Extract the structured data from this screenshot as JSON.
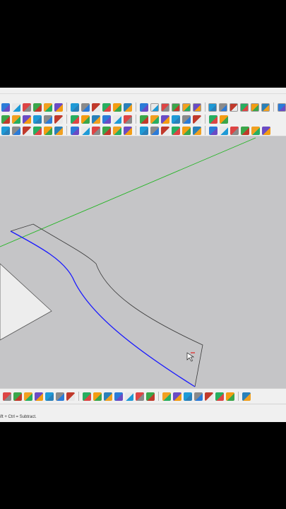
{
  "app": {
    "status_hint": "ift + Ctrl = Subtract."
  },
  "colors": {
    "viewport_bg": "#c5c5c7",
    "green_axis": "#22b522",
    "selected_edge": "#1a1aff",
    "face_edge": "#3a3a3a",
    "ground_plane": "#ededed",
    "cursor_red": "#e02020"
  },
  "toolbar_rows": [
    {
      "icons": [
        "select-icon",
        "lasso-icon",
        "pan-icon",
        "walk-icon",
        "zoom-icon",
        "zoom-extents-icon",
        "orbit-icon",
        "section-icon",
        "section-plane-icon",
        "mirror-icon",
        "person-icon",
        "add-location-icon",
        "iso-view-icon",
        "top-view-icon",
        "front-view-icon",
        "camera-icon",
        "tape-icon",
        "rotate-icon",
        "gear-icon",
        "cube-icon",
        "component-icon",
        "shaded-icon",
        "material-icon",
        "cloud-icon",
        "box-icon"
      ]
    },
    {
      "icons": [
        "paint-icon",
        "box-solid-icon",
        "layer-icon",
        "push-pull-icon",
        "dims-icon",
        "warehouse-icon",
        "paint-bucket-icon",
        "cube-red-icon",
        "cube-green-icon",
        "style-icon",
        "settings-hex-icon",
        "settings-hex-2-icon",
        "undo-icon",
        "redo-icon",
        "play-icon",
        "capture-icon",
        "next-icon",
        "shadow-icon",
        "group-icon",
        "copy-icon"
      ]
    },
    {
      "icons": [
        "material-orange-icon",
        "scissors-icon",
        "curve-icon",
        "frame-icon",
        "frame-2-icon",
        "hex-icon",
        "molecule-icon",
        "sheet-icon",
        "sheet-2-icon",
        "sheet-3-icon",
        "sheet-4-icon",
        "sheet-5-icon",
        "sheet-6-icon",
        "sheet-7-icon",
        "sheet-8-icon",
        "sheet-9-icon",
        "sheet-10-icon",
        "fold-icon",
        "house-icon",
        "pencil-icon",
        "arc-icon",
        "sweep-icon",
        "bend-icon",
        "nurbs-icon"
      ]
    }
  ],
  "bottom_icons": [
    "funnel-icon",
    "filter-icon",
    "lasso-select-icon",
    "explode-icon",
    "shrink-icon",
    "expand-icon",
    "prev-next-icon",
    "view-icon",
    "move-all-icon",
    "spread-icon",
    "drop-icon",
    "tree-icon",
    "shield-icon",
    "coins-icon",
    "coins-2-icon",
    "coins-3-icon",
    "coins-4-icon",
    "coins-5-icon",
    "tag-icon",
    "tag-2-icon",
    "paper-icon",
    "circle-green-icon"
  ]
}
